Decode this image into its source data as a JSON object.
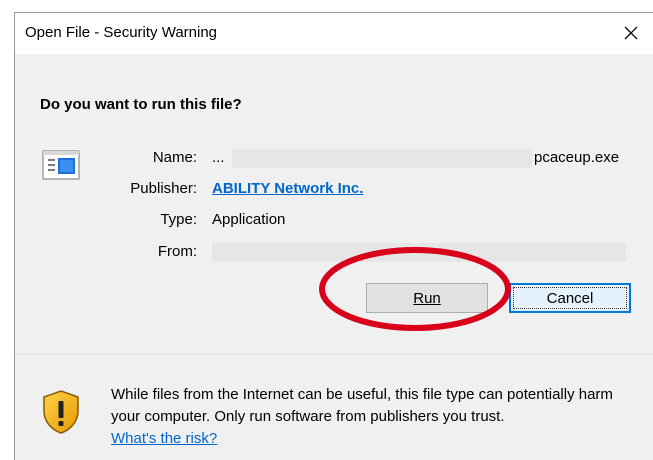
{
  "titlebar": {
    "title": "Open File - Security Warning",
    "close_icon": "close-icon"
  },
  "question": "Do you want to run this file?",
  "details": {
    "name_label": "Name:",
    "name_prefix": "...",
    "name_value": "pcaceup.exe",
    "publisher_label": "Publisher:",
    "publisher_value": "ABILITY Network Inc.",
    "type_label": "Type:",
    "type_value": "Application",
    "from_label": "From:"
  },
  "buttons": {
    "run_label": "Run",
    "cancel_label": "Cancel"
  },
  "footer": {
    "warning_text": "While files from the Internet can be useful, this file type can potentially harm your computer. Only run software from publishers you trust.",
    "risk_link": "What's the risk?"
  },
  "colors": {
    "link": "#0066cc",
    "annotation": "#d9001b",
    "dialog_bg": "#f0f0f0",
    "focus": "#0078d7"
  }
}
